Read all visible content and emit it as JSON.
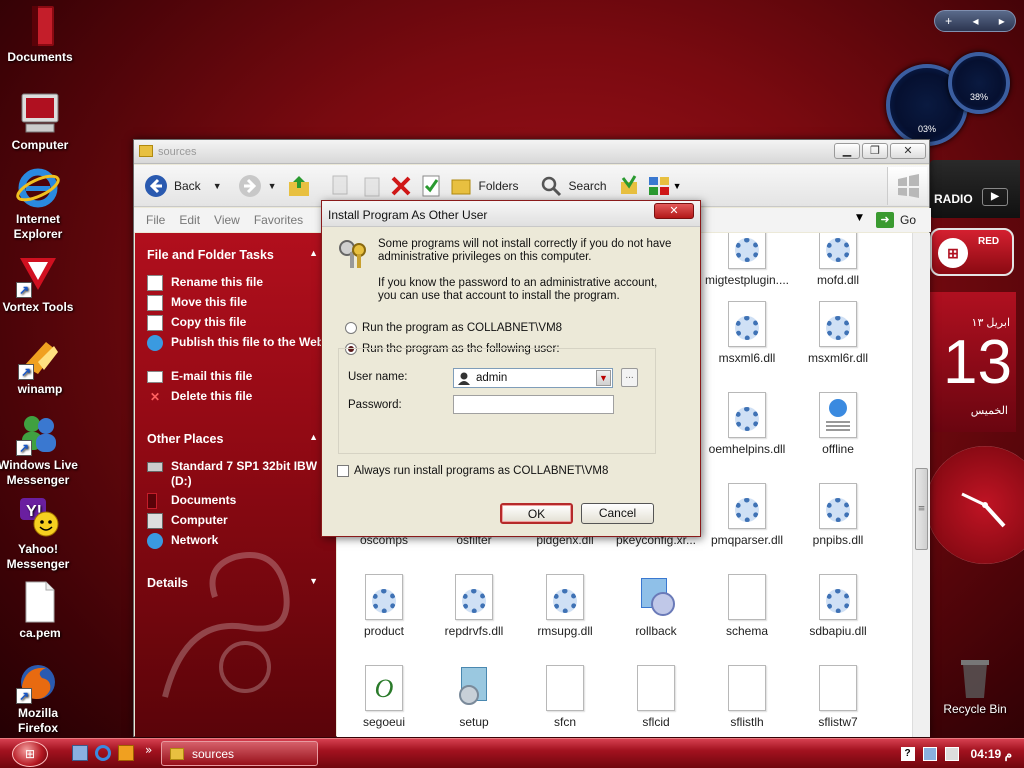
{
  "desktop": {
    "icons": [
      {
        "label": "Documents"
      },
      {
        "label": "Computer"
      },
      {
        "label": "Internet Explorer"
      },
      {
        "label": "Vortex Tools"
      },
      {
        "label": "winamp"
      },
      {
        "label": "Windows Live Messenger"
      },
      {
        "label": "Yahoo! Messenger"
      },
      {
        "label": "ca.pem"
      },
      {
        "label": "Mozilla Firefox"
      }
    ],
    "recycle_bin": "Recycle Bin"
  },
  "gadgets": {
    "top_bar": [
      "+",
      "◂",
      "▸"
    ],
    "gauge_cpu": "03%",
    "gauge_mem": "38%",
    "radio_label": "RADIO",
    "red_label": "RED",
    "calendar_month": "ابريل ١٣",
    "calendar_day": "13",
    "calendar_weekday": "الخميس"
  },
  "window": {
    "title": "sources",
    "toolbar": {
      "back": "Back",
      "folders": "Folders",
      "search": "Search"
    },
    "menu": [
      "File",
      "Edit",
      "View",
      "Favorites"
    ],
    "go": "Go",
    "left_pane": {
      "file_tasks_header": "File and Folder Tasks",
      "file_tasks": [
        "Rename this file",
        "Move this file",
        "Copy this file",
        "Publish this file to the Web",
        "E-mail this file",
        "Delete this file"
      ],
      "other_places_header": "Other Places",
      "other_places": [
        "Standard 7 SP1 32bit IBW (D:)",
        "Documents",
        "Computer",
        "Network"
      ],
      "details_header": "Details"
    },
    "files": [
      {
        "name": "migtestplugin...."
      },
      {
        "name": "mofd.dll"
      },
      {
        "name": "msxml6.dll"
      },
      {
        "name": "msxml6r.dll"
      },
      {
        "name": "oemhelpins.dll"
      },
      {
        "name": "offline"
      },
      {
        "name": "oscomps"
      },
      {
        "name": "osfilter"
      },
      {
        "name": "pidgenx.dll"
      },
      {
        "name": "pkeyconfig.xr..."
      },
      {
        "name": "pmqparser.dll"
      },
      {
        "name": "pnpibs.dll"
      },
      {
        "name": "product"
      },
      {
        "name": "repdrvfs.dll"
      },
      {
        "name": "rmsupg.dll"
      },
      {
        "name": "rollback"
      },
      {
        "name": "schema"
      },
      {
        "name": "sdbapiu.dll"
      },
      {
        "name": "segoeui"
      },
      {
        "name": "setup"
      },
      {
        "name": "sfcn"
      },
      {
        "name": "sflcid"
      },
      {
        "name": "sflistlh"
      },
      {
        "name": "sflistw7"
      }
    ]
  },
  "dialog": {
    "title": "Install Program As Other User",
    "intro_1": "Some programs will not install correctly if you do not have administrative privileges on this computer.",
    "intro_2": "If you know the password to an administrative account, you can use that account to install the program.",
    "option_current": "Run the program as COLLABNET\\VM8",
    "option_other": "Run the program as the following user:",
    "username_label": "User name:",
    "username_value": "admin",
    "password_label": "Password:",
    "password_value": "",
    "always_run": "Always run install programs as COLLABNET\\VM8",
    "ok": "OK",
    "cancel": "Cancel",
    "browse": "..."
  },
  "taskbar": {
    "task": "sources",
    "clock": "04:19 م",
    "ql_more": "»"
  }
}
